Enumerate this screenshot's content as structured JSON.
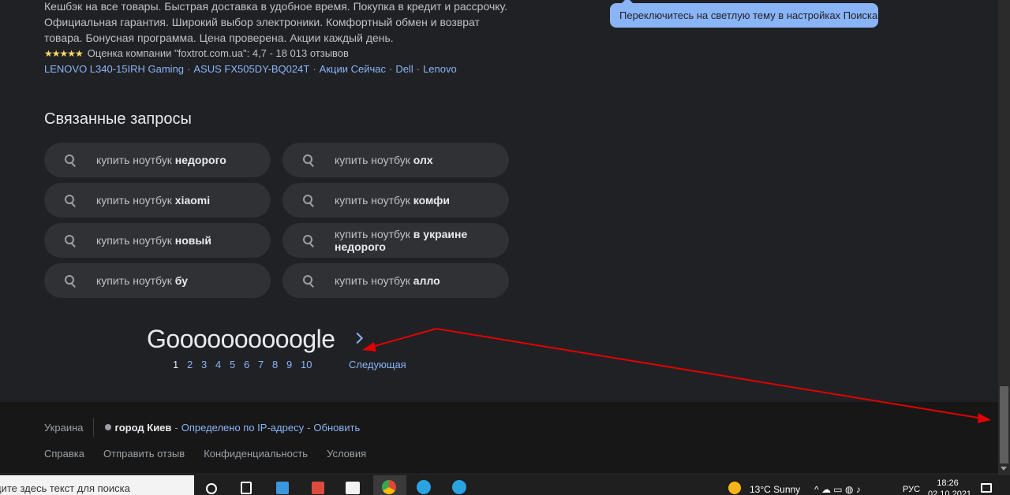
{
  "snippet": {
    "lines": [
      "Кешбэк на все товары. Быстрая доставка в удобное время. Покупка в кредит и рассрочку.",
      "Официальная гарантия. Широкий выбор электроники. Комфортный обмен и возврат",
      "товара. Бонусная программа. Цена проверена. Акции каждый день."
    ],
    "stars": "★★★★★",
    "rating_text": "Оценка компании \"foxtrot.com.ua\": 4,7 - 18 013 отзывов",
    "sitelinks": [
      "LENOVO L340-15IRH Gaming",
      "ASUS FX505DY-BQ024T",
      "Акции Сейчас",
      "Dell",
      "Lenovo"
    ],
    "separator": "·"
  },
  "tooltip": {
    "text": "Переключитесь на светлую тему в настройках Поиска"
  },
  "related": {
    "title": "Связанные запросы",
    "items": [
      {
        "prefix": "купить ноутбук ",
        "bold": "недорого"
      },
      {
        "prefix": "купить ноутбук ",
        "bold": "олх"
      },
      {
        "prefix": "купить ноутбук ",
        "bold": "xiaomi"
      },
      {
        "prefix": "купить ноутбук ",
        "bold": "комфи"
      },
      {
        "prefix": "купить ноутбук ",
        "bold": "новый"
      },
      {
        "prefix": "купить ноутбук ",
        "bold": "в украине недорого"
      },
      {
        "prefix": "купить ноутбук ",
        "bold": "бу"
      },
      {
        "prefix": "купить ноутбук ",
        "bold": "алло"
      }
    ]
  },
  "pager": {
    "logo": "Goooooooooogle",
    "pages": [
      "1",
      "2",
      "3",
      "4",
      "5",
      "6",
      "7",
      "8",
      "9",
      "10"
    ],
    "current": "1",
    "next": "Следующая"
  },
  "footer": {
    "country": "Украина",
    "city": "город Киев",
    "dash": "-",
    "location_link": "Определено по IP-адресу",
    "update_link": "Обновить",
    "links": [
      "Справка",
      "Отправить отзыв",
      "Конфиденциальность",
      "Условия"
    ]
  },
  "taskbar": {
    "search_text": "дите здесь текст для поиска",
    "weather": "13°C  Sunny",
    "tray": "^ ☁ ▭ ◍ ♪",
    "lang": "РУС",
    "time": "18:26",
    "date": "02.10.2021"
  },
  "colors": {
    "background": "#202124",
    "link": "#8ab4f8",
    "chip": "#303134",
    "footer": "#171717",
    "annotation_arrow": "#e00000"
  }
}
